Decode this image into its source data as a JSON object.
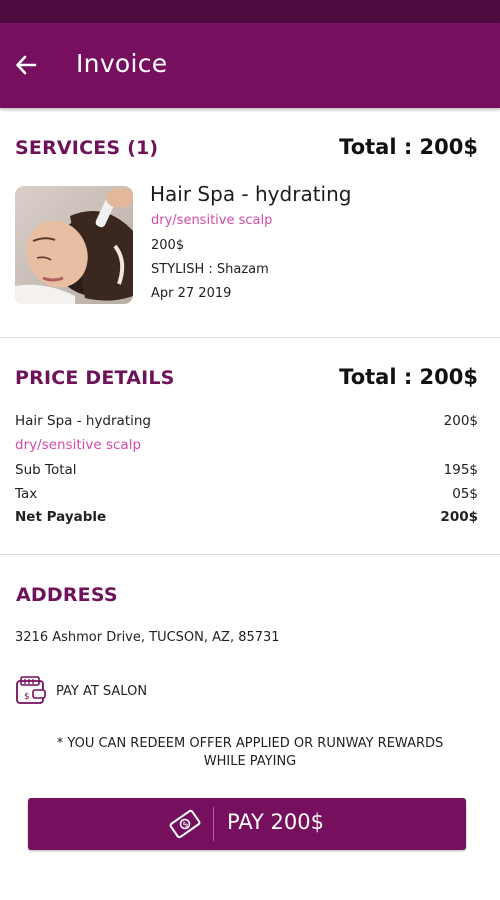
{
  "header": {
    "title": "Invoice",
    "back_icon": "arrow-left-icon"
  },
  "services": {
    "title": "SERVICES (1)",
    "total": "Total : 200$",
    "item": {
      "name": "Hair Spa - hydrating",
      "variant": "dry/sensitive scalp",
      "price": "200$",
      "stylist": "STYLISH : Shazam",
      "date": "Apr 27 2019"
    }
  },
  "price_details": {
    "title": "PRICE DETAILS",
    "total": "Total : 200$",
    "service_name": "Hair Spa - hydrating",
    "service_price": "200$",
    "service_variant": "dry/sensitive scalp",
    "rows": [
      {
        "label": "Sub Total",
        "value": "195$"
      },
      {
        "label": "Tax",
        "value": "05$"
      },
      {
        "label": "Net Payable",
        "value": "200$"
      }
    ]
  },
  "address": {
    "title": "ADDRESS",
    "text": "3216  Ashmor Drive, TUCSON, AZ, 85731"
  },
  "payment": {
    "method_label": "PAY AT SALON",
    "method_icon": "wallet-icon",
    "note_line1": "* YOU CAN REDEEM OFFER APPLIED OR RUNWAY REWARDS",
    "note_line2": "WHILE PAYING",
    "pay_button_label": "PAY 200$",
    "pay_button_icon": "cash-icon"
  },
  "colors": {
    "brand": "#760f5e",
    "statusbar": "#4f0a40",
    "accent_pink": "#d44aa8"
  }
}
